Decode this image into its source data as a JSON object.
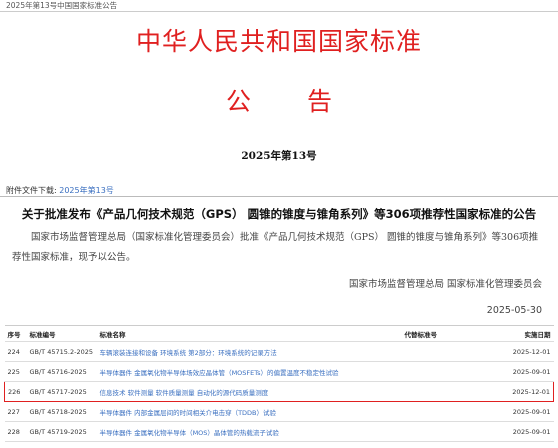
{
  "topbar": {
    "breadcrumb": "2025年第13号中国国家标准公告"
  },
  "header": {
    "country": "中华人民共和国国家标准",
    "notice": "公 告",
    "issue": "2025年第13号"
  },
  "attachment": {
    "label": "附件文件下载:",
    "link": "2025年第13号"
  },
  "announcement": {
    "title": "关于批准发布《产品几何技术规范（GPS） 圆锥的锥度与锥角系列》等306项推荐性国家标准的公告",
    "body": "国家市场监督管理总局（国家标准化管理委员会）批准《产品几何技术规范（GPS） 圆锥的锥度与锥角系列》等306项推荐性国家标准，现予以公告。",
    "signature": "国家市场监督管理总局 国家标准化管理委员会",
    "date": "2025-05-30"
  },
  "table": {
    "headers": {
      "seq": "序号",
      "code": "标准编号",
      "name": "标准名称",
      "replaced": "代替标准号",
      "impl": "实施日期"
    },
    "rows": [
      {
        "seq": "224",
        "code": "GB/T 45715.2-2025",
        "name": "车辆滚装连接和设备 环境系统 第2部分：环境系统的记录方法",
        "replaced": "",
        "impl": "2025-12-01"
      },
      {
        "seq": "225",
        "code": "GB/T 45716-2025",
        "name": "半导体器件 金属氧化物半导体场效应晶体管（MOSFETs）的偏置温度不稳定性试验",
        "replaced": "",
        "impl": "2025-09-01"
      },
      {
        "seq": "226",
        "code": "GB/T 45717-2025",
        "name": "信息技术 软件测量 软件质量测量 自动化的源代码质量测度",
        "replaced": "",
        "impl": "2025-12-01"
      },
      {
        "seq": "227",
        "code": "GB/T 45718-2025",
        "name": "半导体器件 内部金属层间的时间相关介电击穿（TDDB）试验",
        "replaced": "",
        "impl": "2025-09-01"
      },
      {
        "seq": "228",
        "code": "GB/T 45719-2025",
        "name": "半导体器件 金属氧化物半导体（MOS）晶体管的热载流子试验",
        "replaced": "",
        "impl": "2025-09-01"
      }
    ]
  },
  "colors": {
    "accent_red": "#e02020",
    "link_blue": "#3a6fc0"
  }
}
